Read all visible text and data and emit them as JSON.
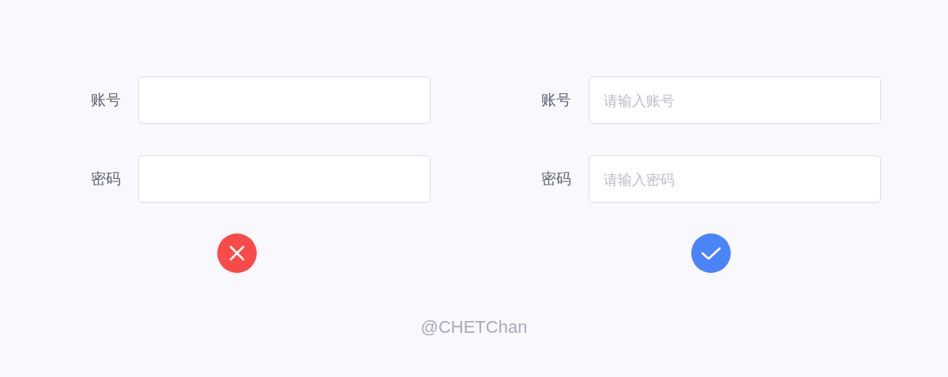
{
  "examples": [
    {
      "kind": "wrong",
      "fields": [
        {
          "label": "账号"
        },
        {
          "label": "密码"
        }
      ]
    },
    {
      "kind": "right",
      "fields": [
        {
          "label": "账号",
          "placeholder": "请输入账号"
        },
        {
          "label": "密码",
          "placeholder": "请输入密码"
        }
      ]
    }
  ],
  "signature": "@CHETChan"
}
